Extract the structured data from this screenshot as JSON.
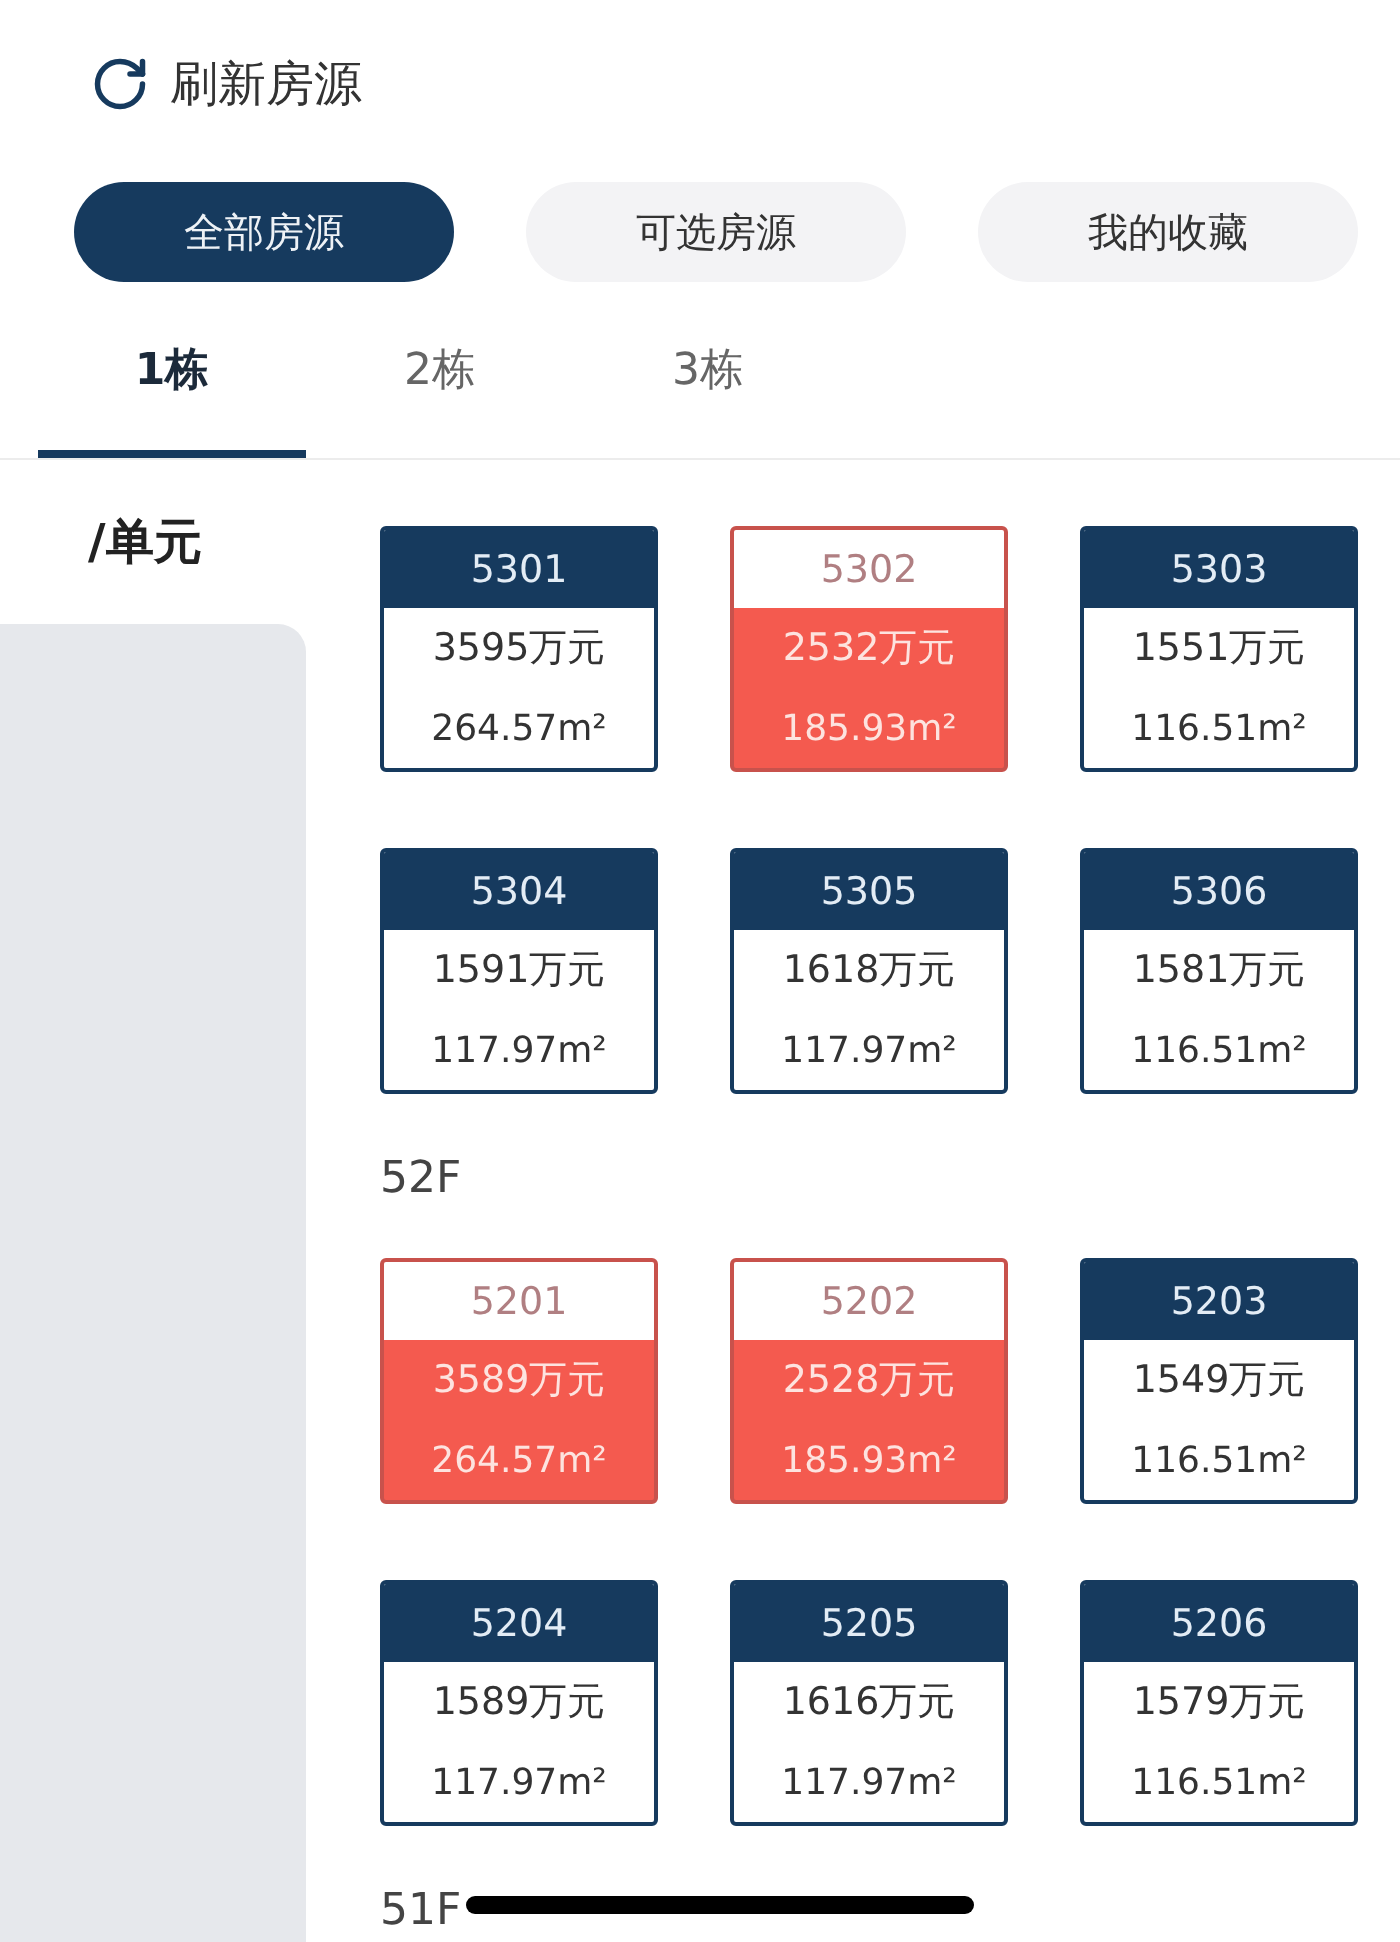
{
  "refresh": {
    "label": "刷新房源"
  },
  "filters": [
    {
      "label": "全部房源",
      "selected": true
    },
    {
      "label": "可选房源",
      "selected": false
    },
    {
      "label": "我的收藏",
      "selected": false
    }
  ],
  "building_tabs": [
    {
      "label": "1栋",
      "selected": true
    },
    {
      "label": "2栋",
      "selected": false
    },
    {
      "label": "3栋",
      "selected": false
    }
  ],
  "sidebar": {
    "items": [
      {
        "label": "/单元",
        "selected": true
      }
    ]
  },
  "floors": [
    {
      "units": [
        {
          "number": "5301",
          "price": "3595万元",
          "area": "264.57m²",
          "sold": false
        },
        {
          "number": "5302",
          "price": "2532万元",
          "area": "185.93m²",
          "sold": true
        },
        {
          "number": "5303",
          "price": "1551万元",
          "area": "116.51m²",
          "sold": false
        },
        {
          "number": "5304",
          "price": "1591万元",
          "area": "117.97m²",
          "sold": false
        },
        {
          "number": "5305",
          "price": "1618万元",
          "area": "117.97m²",
          "sold": false
        },
        {
          "number": "5306",
          "price": "1581万元",
          "area": "116.51m²",
          "sold": false
        }
      ]
    },
    {
      "label": "52F",
      "units": [
        {
          "number": "5201",
          "price": "3589万元",
          "area": "264.57m²",
          "sold": true
        },
        {
          "number": "5202",
          "price": "2528万元",
          "area": "185.93m²",
          "sold": true
        },
        {
          "number": "5203",
          "price": "1549万元",
          "area": "116.51m²",
          "sold": false
        },
        {
          "number": "5204",
          "price": "1589万元",
          "area": "117.97m²",
          "sold": false
        },
        {
          "number": "5205",
          "price": "1616万元",
          "area": "117.97m²",
          "sold": false
        },
        {
          "number": "5206",
          "price": "1579万元",
          "area": "116.51m²",
          "sold": false
        }
      ]
    },
    {
      "label": "51F"
    }
  ]
}
